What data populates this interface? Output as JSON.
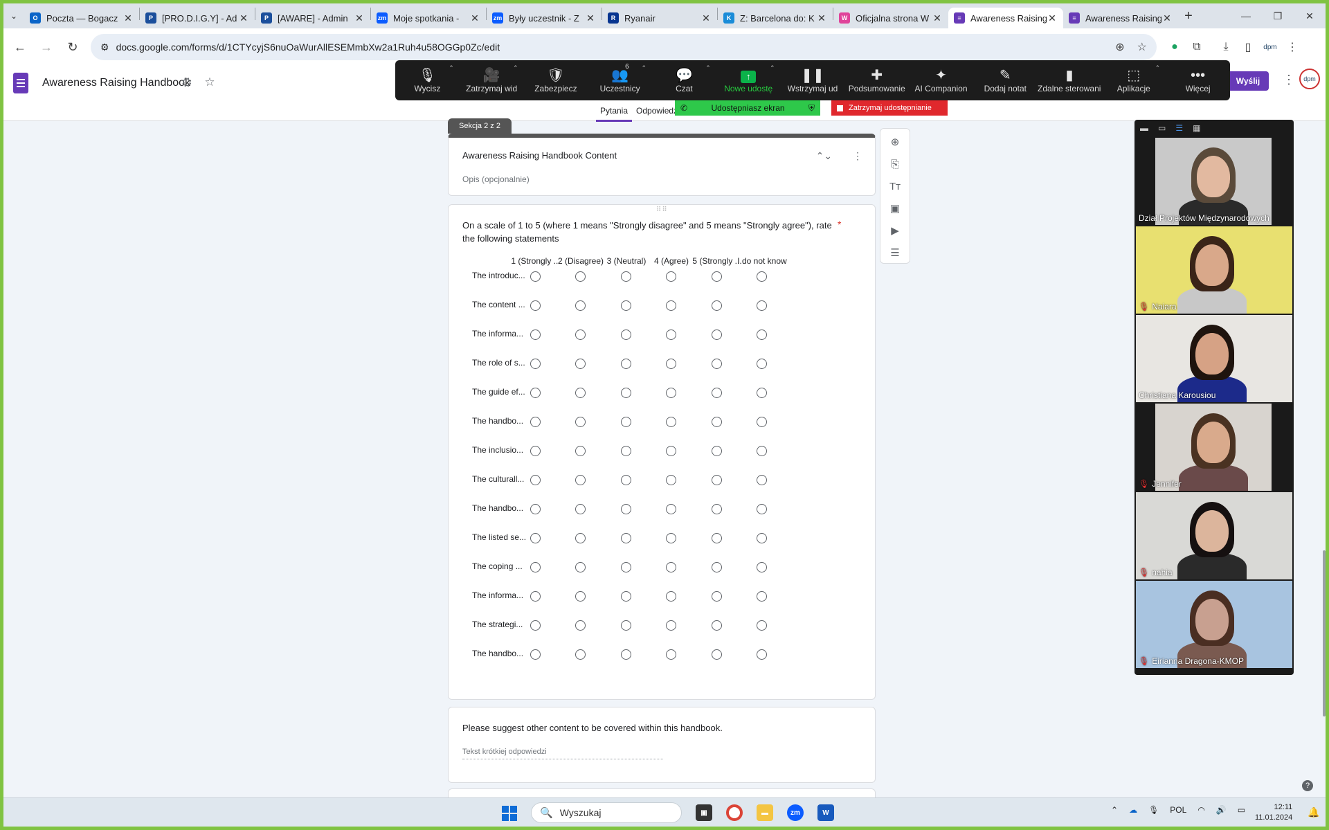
{
  "browser": {
    "tabs": [
      {
        "title": "Poczta — Bogacz",
        "color": "#0a64c8",
        "glyph": "O"
      },
      {
        "title": "[PRO.D.I.G.Y] - Ad",
        "color": "#1b4f9c",
        "glyph": "P"
      },
      {
        "title": "[AWARE] - Admin",
        "color": "#1b4f9c",
        "glyph": "P"
      },
      {
        "title": "Moje spotkania -",
        "color": "#0b5cff",
        "glyph": "zm"
      },
      {
        "title": "Były uczestnik - Z",
        "color": "#0b5cff",
        "glyph": "zm"
      },
      {
        "title": "Ryanair",
        "color": "#073590",
        "glyph": "R"
      },
      {
        "title": "Z: Barcelona do: K",
        "color": "#1a8cd8",
        "glyph": "K"
      },
      {
        "title": "Oficjalna strona W",
        "color": "#e0449a",
        "glyph": "W"
      },
      {
        "title": "Awareness Raising",
        "color": "#673ab7",
        "glyph": "≡"
      },
      {
        "title": "Awareness Raising",
        "color": "#673ab7",
        "glyph": "≡"
      }
    ],
    "url": "docs.google.com/forms/d/1CTYcyjS6nuOaWurAllESEMmbXw2a1Ruh4u58OGGp0Zc/edit"
  },
  "form": {
    "title": "Awareness Raising Handbook",
    "tabs": {
      "questions": "Pytania",
      "responses": "Odpowiedzi"
    },
    "send_label": "Wyślij",
    "avatar_text": "dpm",
    "section_badge": "Sekcja 2 z 2",
    "section_title": "Awareness Raising Handbook Content",
    "section_desc": "Opis (opcjonalnie)",
    "grid_question": "On a scale of 1 to 5 (where 1 means \"Strongly disagree\" and 5 means \"Strongly agree\"), rate the following statements",
    "required_mark": "*",
    "columns": [
      "1 (Strongly ...",
      "2 (Disagree)",
      "3 (Neutral)",
      "4 (Agree)",
      "5 (Strongly ...",
      "I do not know"
    ],
    "rows": [
      "The introduc...",
      "The content ...",
      "The informa...",
      "The role of s...",
      "The guide ef...",
      "The handbo...",
      "The inclusio...",
      "The culturall...",
      "The handbo...",
      "The listed se...",
      "The coping ...",
      "The informa...",
      "The strategi...",
      "The handbo..."
    ],
    "q3_text": "Please suggest other content to be covered within this handbook.",
    "q3_placeholder": "Tekst krótkiej odpowiedzi"
  },
  "zoom": {
    "toolbar": [
      {
        "label": "Wycisz",
        "icon": "🎙",
        "caret": true
      },
      {
        "label": "Zatrzymaj wid",
        "icon": "🎥",
        "caret": true
      },
      {
        "label": "Zabezpiecz",
        "icon": "🛡",
        "caret": false
      },
      {
        "label": "Uczestnicy",
        "icon": "👥",
        "caret": true,
        "badge": "6"
      },
      {
        "label": "Czat",
        "icon": "💬",
        "caret": true
      },
      {
        "label": "Nowe udostę",
        "icon": "↑",
        "caret": true,
        "green": true
      },
      {
        "label": "Wstrzymaj ud",
        "icon": "❚❚",
        "caret": false
      },
      {
        "label": "Podsumowanie",
        "icon": "✚",
        "caret": false
      },
      {
        "label": "AI Companion",
        "icon": "✦",
        "caret": false
      },
      {
        "label": "Dodaj notat",
        "icon": "✎",
        "caret": false
      },
      {
        "label": "Zdalne sterowanie",
        "icon": "▮",
        "caret": false
      },
      {
        "label": "Aplikacje",
        "icon": "⬚",
        "caret": true
      },
      {
        "label": "Więcej",
        "icon": "•••",
        "caret": false
      }
    ],
    "sharing_label": "Udostępniasz ekran",
    "stop_label": "Zatrzymaj udostępnianie",
    "participants": [
      {
        "name": "Dział Projektów Międzynarodowych",
        "muted": false,
        "bg": "#c9c9c9",
        "skin": "#e2b9a0",
        "hair": "#5a4a3a",
        "shirt": "#2a2a2a"
      },
      {
        "name": "Naiara",
        "muted": true,
        "bg": "#e8e070",
        "skin": "#d9a88a",
        "hair": "#3a2418",
        "shirt": "#c8c8c8"
      },
      {
        "name": "Christiana Karousiou",
        "muted": false,
        "bg": "#e8e6e2",
        "skin": "#d6a285",
        "hair": "#1f140e",
        "shirt": "#1c2a8a"
      },
      {
        "name": "Jennifer",
        "muted": true,
        "bg": "#d8d4cf",
        "skin": "#d9aa8c",
        "hair": "#4a3222",
        "shirt": "#6a4a4a"
      },
      {
        "name": "nahia",
        "muted": true,
        "bg": "#d9d9d6",
        "skin": "#dcb59c",
        "hair": "#151010",
        "shirt": "#2a2a2a"
      },
      {
        "name": "Eirianna Dragona-KMOP",
        "muted": true,
        "bg": "#a8c4e0",
        "skin": "#c8a090",
        "hair": "#4a2e22",
        "shirt": "#7a5a50"
      }
    ]
  },
  "taskbar": {
    "search_placeholder": "Wyszukaj",
    "lang": "POL",
    "time": "12:11",
    "date": "11.01.2024"
  }
}
